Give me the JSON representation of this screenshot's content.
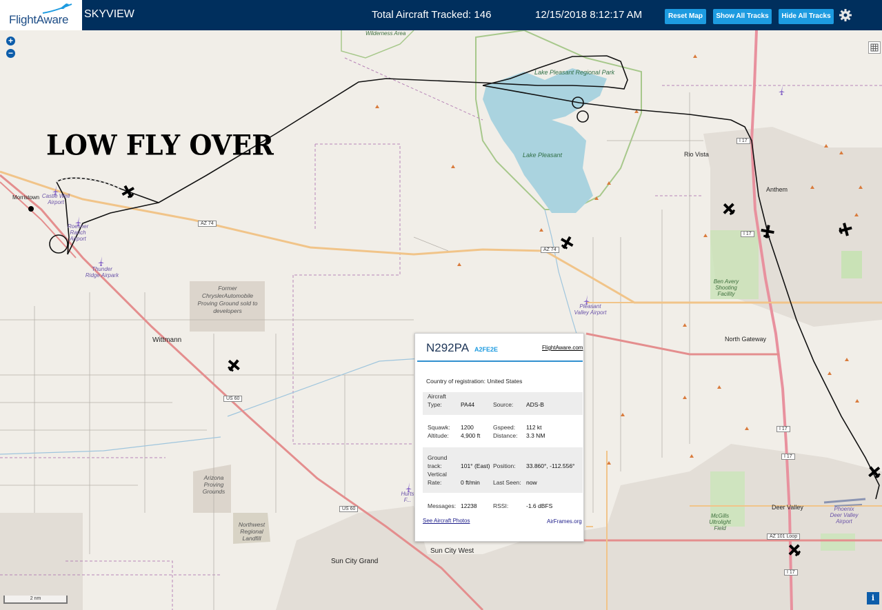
{
  "header": {
    "logo_text": "FlightAware",
    "app_name": "SKYVIEW",
    "tracked": "Total Aircraft Tracked: 146",
    "datetime": "12/15/2018 8:12:17 AM",
    "reset_label": "Reset Map",
    "show_label": "Show All Tracks",
    "hide_label": "Hide All Tracks"
  },
  "overlay": {
    "annotation": "LOW FLY OVER"
  },
  "map": {
    "labels": {
      "wilderness": "Wilderness Area",
      "lake_park": "Lake Pleasant Regional Park",
      "lake": "Lake Pleasant",
      "rio_vista": "Rio Vista",
      "anthem": "Anthem",
      "morristown": "Morristown",
      "castle_well": "Castle Well Airport",
      "roesner": "Roesner Ranch Airport",
      "thunder": "Thunder Ridge Airpark",
      "chrysler": "Former ChryslerAutomobile Proving Ground sold to developers",
      "wittmann": "Wittmann",
      "pleasant_valley": "Pleasant Valley Airport",
      "ben_avery": "Ben Avery Shooting Facility",
      "north_gateway": "North Gateway",
      "arizona_proving": "Arizona Proving Grounds",
      "nw_landfill": "Northwest Regional Landfill",
      "hurts": "Hurts F... (histori...",
      "sun_city_west": "Sun City West",
      "sun_city_grand": "Sun City Grand",
      "deer_valley": "Deer Valley",
      "phoenix_deer": "Phoenix Deer Valley Airport",
      "mcgills": "McGills Ultrolight Field",
      "scale": "2 nm"
    },
    "shields": {
      "az74_a": "AZ 74",
      "az74_b": "AZ 74",
      "us60_a": "US 60",
      "us60_b": "US 60",
      "i17_a": "I 17",
      "i17_b": "I 17",
      "i17_c": "I 17",
      "i17_d": "I 17",
      "i17_e": "I 17",
      "az101": "AZ 101 Loop"
    }
  },
  "popup": {
    "registration": "N292PA",
    "hex": "A2FE2E",
    "fa_link": "FlightAware.com",
    "country_label": "Country of registration:",
    "country_value": "United States",
    "aircraft_type_label": "Aircraft Type:",
    "aircraft_type": "PA44",
    "source_label": "Source:",
    "source": "ADS-B",
    "squawk_label": "Squawk:",
    "squawk": "1200",
    "gspeed_label": "Gspeed:",
    "gspeed": "112 kt",
    "altitude_label": "Altitude:",
    "altitude": "4,900 ft",
    "distance_label": "Distance:",
    "distance": "3.3 NM",
    "ground_track_label": "Ground track:",
    "ground_track": "101° (East)",
    "position_label": "Position:",
    "position": "33.860°, -112.556°",
    "vertical_rate_label": "Vertical Rate:",
    "vertical_rate": "0 ft/min",
    "last_seen_label": "Last Seen:",
    "last_seen": "now",
    "messages_label": "Messages:",
    "messages": "12238",
    "rssi_label": "RSSI:",
    "rssi": "-1.6 dBFS",
    "photos_link": "See Aircraft Photos",
    "airframes_link": "AirFrames.org"
  },
  "colors": {
    "header_bg": "#002f5d",
    "button": "#1d9be0",
    "lake": "#aad3df",
    "highway": "#e892a2"
  }
}
